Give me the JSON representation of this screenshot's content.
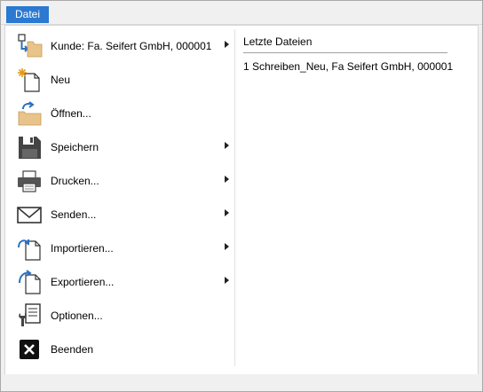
{
  "tab": {
    "label": "Datei"
  },
  "menu": {
    "items": [
      {
        "label": "Kunde: Fa. Seifert GmbH, 000001",
        "icon": "customer-folder-icon",
        "submenu": true
      },
      {
        "label": "Neu",
        "icon": "new-document-icon",
        "submenu": false
      },
      {
        "label": "Öffnen...",
        "icon": "open-folder-icon",
        "submenu": false
      },
      {
        "label": "Speichern",
        "icon": "save-icon",
        "submenu": true
      },
      {
        "label": "Drucken...",
        "icon": "printer-icon",
        "submenu": true
      },
      {
        "label": "Senden...",
        "icon": "mail-icon",
        "submenu": true
      },
      {
        "label": "Importieren...",
        "icon": "import-icon",
        "submenu": true
      },
      {
        "label": "Exportieren...",
        "icon": "export-icon",
        "submenu": true
      },
      {
        "label": "Optionen...",
        "icon": "options-icon",
        "submenu": false
      },
      {
        "label": "Beenden",
        "icon": "exit-icon",
        "submenu": false
      }
    ]
  },
  "recent": {
    "title": "Letzte Dateien",
    "items": [
      "1 Schreiben_Neu, Fa  Seifert GmbH, 000001"
    ]
  },
  "colors": {
    "accent": "#2b79d0",
    "folder": "#e8c48a",
    "arrow": "#2b6fc0"
  }
}
